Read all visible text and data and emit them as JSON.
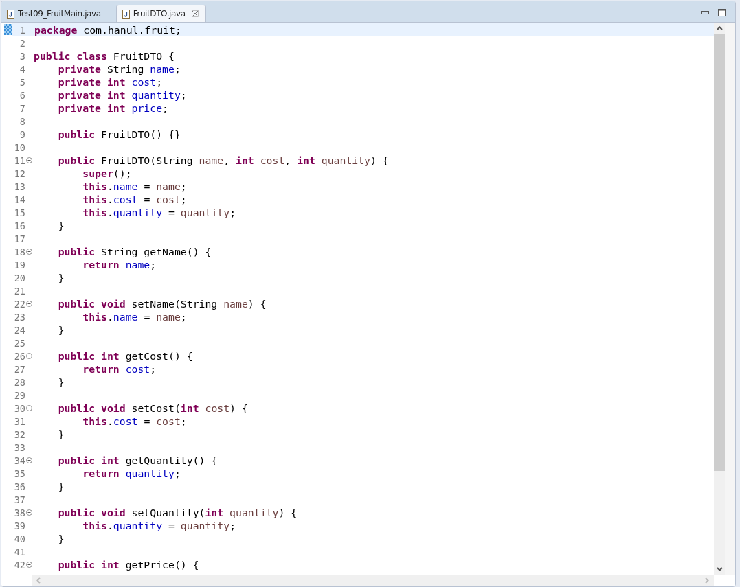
{
  "tabs": [
    {
      "label": "Test09_FruitMain.java",
      "selected": false,
      "closable": false
    },
    {
      "label": "FruitDTO.java",
      "selected": true,
      "closable": true
    }
  ],
  "editor": {
    "lines": [
      {
        "number": "1",
        "current": true,
        "fold": false,
        "tokens": [
          {
            "kind": "keyword",
            "text": "package"
          },
          {
            "kind": "plain",
            "text": " com.hanul.fruit;"
          }
        ]
      },
      {
        "number": "2",
        "current": false,
        "fold": false
      },
      {
        "number": "3",
        "current": false,
        "fold": false,
        "tokens": [
          {
            "kind": "keyword",
            "text": "public class"
          },
          {
            "kind": "plain",
            "text": " FruitDTO {"
          }
        ]
      },
      {
        "number": "4",
        "current": false,
        "fold": false,
        "tokens": [
          {
            "kind": "keyword",
            "text": "    private"
          },
          {
            "kind": "plain",
            "text": " String "
          },
          {
            "kind": "field",
            "text": "name"
          },
          {
            "kind": "plain",
            "text": ";"
          }
        ]
      },
      {
        "number": "5",
        "current": false,
        "fold": false,
        "tokens": [
          {
            "kind": "keyword",
            "text": "    private int "
          },
          {
            "kind": "field",
            "text": "cost"
          },
          {
            "kind": "plain",
            "text": ";"
          }
        ]
      },
      {
        "number": "6",
        "current": false,
        "fold": false,
        "tokens": [
          {
            "kind": "keyword",
            "text": "    private int "
          },
          {
            "kind": "field",
            "text": "quantity"
          },
          {
            "kind": "plain",
            "text": ";"
          }
        ]
      },
      {
        "number": "7",
        "current": false,
        "fold": false,
        "tokens": [
          {
            "kind": "keyword",
            "text": "    private int "
          },
          {
            "kind": "field",
            "text": "price"
          },
          {
            "kind": "plain",
            "text": ";"
          }
        ]
      },
      {
        "number": "8",
        "current": false,
        "fold": false
      },
      {
        "number": "9",
        "current": false,
        "fold": false,
        "tokens": [
          {
            "kind": "keyword",
            "text": "    public"
          },
          {
            "kind": "plain",
            "text": " FruitDTO() {}"
          }
        ]
      },
      {
        "number": "10",
        "current": false,
        "fold": false
      },
      {
        "number": "11",
        "current": false,
        "fold": true,
        "tokens": [
          {
            "kind": "keyword",
            "text": "    public"
          },
          {
            "kind": "plain",
            "text": " FruitDTO(String "
          },
          {
            "kind": "param",
            "text": "name"
          },
          {
            "kind": "plain",
            "text": ", "
          },
          {
            "kind": "keyword",
            "text": "int "
          },
          {
            "kind": "param",
            "text": "cost"
          },
          {
            "kind": "plain",
            "text": ", "
          },
          {
            "kind": "keyword",
            "text": "int "
          },
          {
            "kind": "param",
            "text": "quantity"
          },
          {
            "kind": "plain",
            "text": ") {"
          }
        ]
      },
      {
        "number": "12",
        "current": false,
        "fold": false,
        "tokens": [
          {
            "kind": "keyword",
            "text": "        super"
          },
          {
            "kind": "plain",
            "text": "();"
          }
        ]
      },
      {
        "number": "13",
        "current": false,
        "fold": false,
        "tokens": [
          {
            "kind": "keyword",
            "text": "        this"
          },
          {
            "kind": "plain",
            "text": "."
          },
          {
            "kind": "field",
            "text": "name"
          },
          {
            "kind": "plain",
            "text": " = "
          },
          {
            "kind": "param",
            "text": "name"
          },
          {
            "kind": "plain",
            "text": ";"
          }
        ]
      },
      {
        "number": "14",
        "current": false,
        "fold": false,
        "tokens": [
          {
            "kind": "keyword",
            "text": "        this"
          },
          {
            "kind": "plain",
            "text": "."
          },
          {
            "kind": "field",
            "text": "cost"
          },
          {
            "kind": "plain",
            "text": " = "
          },
          {
            "kind": "param",
            "text": "cost"
          },
          {
            "kind": "plain",
            "text": ";"
          }
        ]
      },
      {
        "number": "15",
        "current": false,
        "fold": false,
        "tokens": [
          {
            "kind": "keyword",
            "text": "        this"
          },
          {
            "kind": "plain",
            "text": "."
          },
          {
            "kind": "field",
            "text": "quantity"
          },
          {
            "kind": "plain",
            "text": " = "
          },
          {
            "kind": "param",
            "text": "quantity"
          },
          {
            "kind": "plain",
            "text": ";"
          }
        ]
      },
      {
        "number": "16",
        "current": false,
        "fold": false,
        "tokens": [
          {
            "kind": "plain",
            "text": "    }"
          }
        ]
      },
      {
        "number": "17",
        "current": false,
        "fold": false
      },
      {
        "number": "18",
        "current": false,
        "fold": true,
        "tokens": [
          {
            "kind": "keyword",
            "text": "    public"
          },
          {
            "kind": "plain",
            "text": " String getName() {"
          }
        ]
      },
      {
        "number": "19",
        "current": false,
        "fold": false,
        "tokens": [
          {
            "kind": "keyword",
            "text": "        return "
          },
          {
            "kind": "field",
            "text": "name"
          },
          {
            "kind": "plain",
            "text": ";"
          }
        ]
      },
      {
        "number": "20",
        "current": false,
        "fold": false,
        "tokens": [
          {
            "kind": "plain",
            "text": "    }"
          }
        ]
      },
      {
        "number": "21",
        "current": false,
        "fold": false
      },
      {
        "number": "22",
        "current": false,
        "fold": true,
        "tokens": [
          {
            "kind": "keyword",
            "text": "    public void"
          },
          {
            "kind": "plain",
            "text": " setName(String "
          },
          {
            "kind": "param",
            "text": "name"
          },
          {
            "kind": "plain",
            "text": ") {"
          }
        ]
      },
      {
        "number": "23",
        "current": false,
        "fold": false,
        "tokens": [
          {
            "kind": "keyword",
            "text": "        this"
          },
          {
            "kind": "plain",
            "text": "."
          },
          {
            "kind": "field",
            "text": "name"
          },
          {
            "kind": "plain",
            "text": " = "
          },
          {
            "kind": "param",
            "text": "name"
          },
          {
            "kind": "plain",
            "text": ";"
          }
        ]
      },
      {
        "number": "24",
        "current": false,
        "fold": false,
        "tokens": [
          {
            "kind": "plain",
            "text": "    }"
          }
        ]
      },
      {
        "number": "25",
        "current": false,
        "fold": false
      },
      {
        "number": "26",
        "current": false,
        "fold": true,
        "tokens": [
          {
            "kind": "keyword",
            "text": "    public int"
          },
          {
            "kind": "plain",
            "text": " getCost() {"
          }
        ]
      },
      {
        "number": "27",
        "current": false,
        "fold": false,
        "tokens": [
          {
            "kind": "keyword",
            "text": "        return "
          },
          {
            "kind": "field",
            "text": "cost"
          },
          {
            "kind": "plain",
            "text": ";"
          }
        ]
      },
      {
        "number": "28",
        "current": false,
        "fold": false,
        "tokens": [
          {
            "kind": "plain",
            "text": "    }"
          }
        ]
      },
      {
        "number": "29",
        "current": false,
        "fold": false
      },
      {
        "number": "30",
        "current": false,
        "fold": true,
        "tokens": [
          {
            "kind": "keyword",
            "text": "    public void"
          },
          {
            "kind": "plain",
            "text": " setCost("
          },
          {
            "kind": "keyword",
            "text": "int "
          },
          {
            "kind": "param",
            "text": "cost"
          },
          {
            "kind": "plain",
            "text": ") {"
          }
        ]
      },
      {
        "number": "31",
        "current": false,
        "fold": false,
        "tokens": [
          {
            "kind": "keyword",
            "text": "        this"
          },
          {
            "kind": "plain",
            "text": "."
          },
          {
            "kind": "field",
            "text": "cost"
          },
          {
            "kind": "plain",
            "text": " = "
          },
          {
            "kind": "param",
            "text": "cost"
          },
          {
            "kind": "plain",
            "text": ";"
          }
        ]
      },
      {
        "number": "32",
        "current": false,
        "fold": false,
        "tokens": [
          {
            "kind": "plain",
            "text": "    }"
          }
        ]
      },
      {
        "number": "33",
        "current": false,
        "fold": false
      },
      {
        "number": "34",
        "current": false,
        "fold": true,
        "tokens": [
          {
            "kind": "keyword",
            "text": "    public int"
          },
          {
            "kind": "plain",
            "text": " getQuantity() {"
          }
        ]
      },
      {
        "number": "35",
        "current": false,
        "fold": false,
        "tokens": [
          {
            "kind": "keyword",
            "text": "        return "
          },
          {
            "kind": "field",
            "text": "quantity"
          },
          {
            "kind": "plain",
            "text": ";"
          }
        ]
      },
      {
        "number": "36",
        "current": false,
        "fold": false,
        "tokens": [
          {
            "kind": "plain",
            "text": "    }"
          }
        ]
      },
      {
        "number": "37",
        "current": false,
        "fold": false
      },
      {
        "number": "38",
        "current": false,
        "fold": true,
        "tokens": [
          {
            "kind": "keyword",
            "text": "    public void"
          },
          {
            "kind": "plain",
            "text": " setQuantity("
          },
          {
            "kind": "keyword",
            "text": "int "
          },
          {
            "kind": "param",
            "text": "quantity"
          },
          {
            "kind": "plain",
            "text": ") {"
          }
        ]
      },
      {
        "number": "39",
        "current": false,
        "fold": false,
        "tokens": [
          {
            "kind": "keyword",
            "text": "        this"
          },
          {
            "kind": "plain",
            "text": "."
          },
          {
            "kind": "field",
            "text": "quantity"
          },
          {
            "kind": "plain",
            "text": " = "
          },
          {
            "kind": "param",
            "text": "quantity"
          },
          {
            "kind": "plain",
            "text": ";"
          }
        ]
      },
      {
        "number": "40",
        "current": false,
        "fold": false,
        "tokens": [
          {
            "kind": "plain",
            "text": "    }"
          }
        ]
      },
      {
        "number": "41",
        "current": false,
        "fold": false
      },
      {
        "number": "42",
        "current": false,
        "fold": true,
        "tokens": [
          {
            "kind": "keyword",
            "text": "    public int"
          },
          {
            "kind": "plain",
            "text": " getPrice() {"
          }
        ]
      }
    ]
  }
}
